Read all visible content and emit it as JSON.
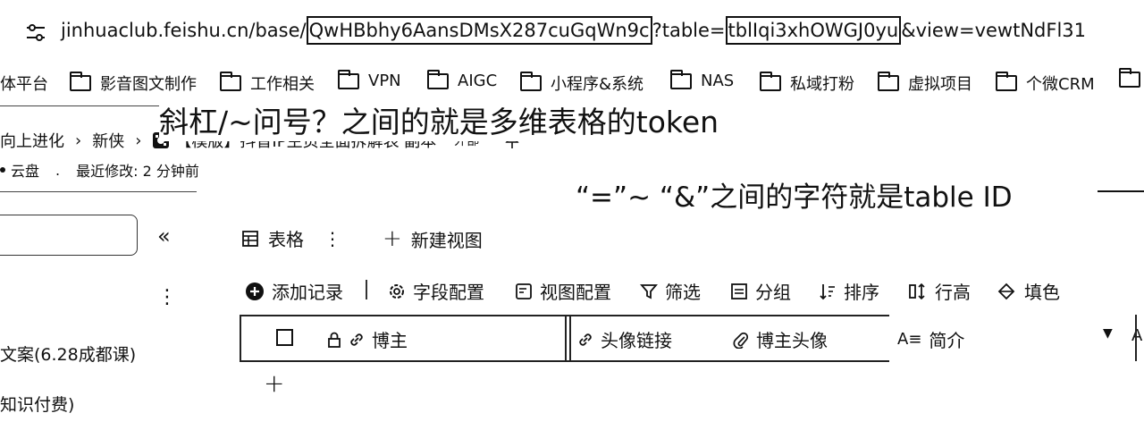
{
  "url": {
    "prefix": "jinhuaclub.feishu.cn/base/",
    "token": "QwHBbhy6AansDMsX287cuGqWn9c",
    "middle": "?table=",
    "table_id": "tblIqi3xhOWGJ0yu",
    "suffix": "&view=vewtNdFl31"
  },
  "bookmarks": [
    "体平台",
    "影音图文制作",
    "工作相关",
    "VPN",
    "AIGC",
    "小程序&系统",
    "NAS",
    "私域打粉",
    "虚拟项目",
    "个微CRM"
  ],
  "annotations": {
    "token_note": "斜杠/~问号？之间的就是多维表格的token",
    "table_note": "“=”~ “&”之间的字符就是table ID"
  },
  "breadcrumb": {
    "item1": "向上进化",
    "item2": "新侠",
    "doc_title": "【模版】抖音IP主页全面拆解表 副本",
    "tag": "外部"
  },
  "meta": {
    "location": "云盘",
    "modified": "最近修改: 2 分钟前"
  },
  "sidebar": {
    "items": [
      "文案(6.28成都课)",
      "知识付费)"
    ]
  },
  "views": {
    "table_label": "表格",
    "new_view": "新建视图"
  },
  "toolbar": {
    "add_record": "添加记录",
    "field_config": "字段配置",
    "view_config": "视图配置",
    "filter": "筛选",
    "group": "分组",
    "sort": "排序",
    "row_height": "行高",
    "fill_color": "填色"
  },
  "columns": {
    "blogger": "博主",
    "avatar_link": "头像链接",
    "blogger_avatar": "博主头像",
    "intro": "简介"
  }
}
